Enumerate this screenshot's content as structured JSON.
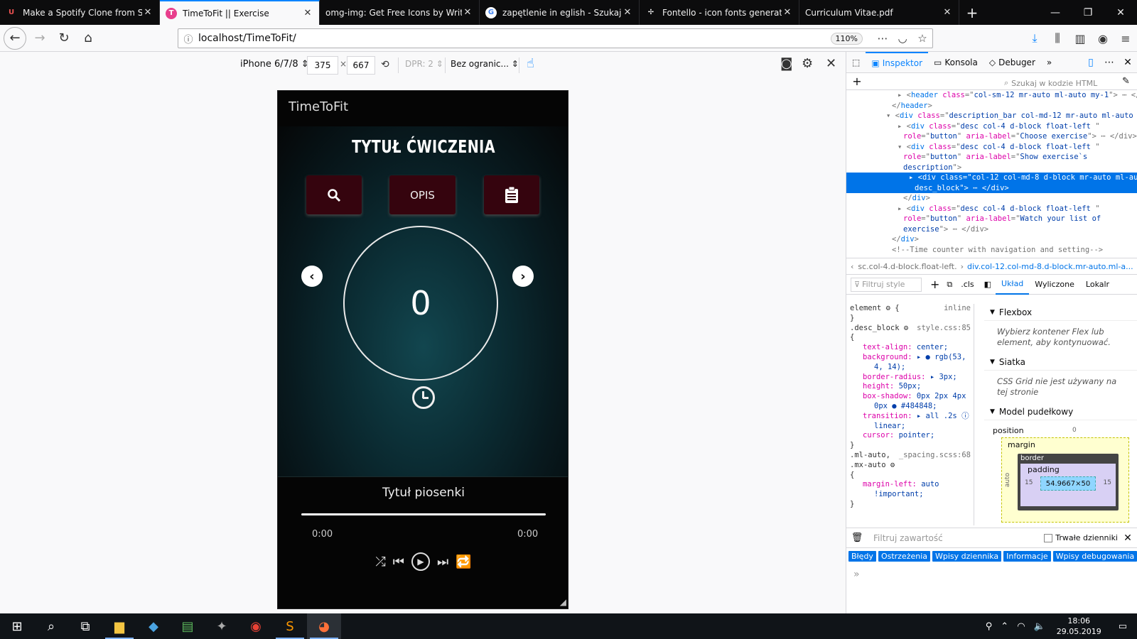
{
  "tabs": [
    {
      "title": "Make a Spotify Clone from Scra",
      "active": false
    },
    {
      "title": "TimeToFit || Exercise",
      "active": true
    },
    {
      "title": "omg-img: Get Free Icons by Writin",
      "active": false
    },
    {
      "title": "zapętlenie in eglish - Szukaj w G",
      "active": false
    },
    {
      "title": "Fontello - icon fonts generator",
      "active": false
    },
    {
      "title": "Curriculum Vitae.pdf",
      "active": false
    }
  ],
  "address": {
    "url": "localhost/TimeToFit/",
    "zoom": "110%"
  },
  "rdm": {
    "device": "iPhone 6/7/8 ⇕",
    "width": "375",
    "height": "667",
    "dpr": "DPR: 2 ⇕",
    "throttle": "Bez ogranic... ⇕"
  },
  "app": {
    "brand": "TimeToFit",
    "exercise_title": "TYTUŁ ĆWICZENIA",
    "opis_button": "OPIS",
    "timer_value": "0",
    "song_title": "Tytuł piosenki",
    "time_left": "0:00",
    "time_right": "0:00"
  },
  "devtools": {
    "tabs": {
      "inspector": "Inspektor",
      "console": "Konsola",
      "debugger": "Debuger"
    },
    "search_placeholder": "Szukaj w kodzie HTML",
    "tree": [
      {
        "indent": 8,
        "html": "▸ &lt;<span class='tag'>header</span> <span class='attr'>class</span>=\"<span class='aval'>col-sm-12 mr-auto ml-auto my-1</span>\"&gt; ⋯ &lt;/header&gt;"
      },
      {
        "indent": 7,
        "html": "&lt;/<span class='tag'>header</span>&gt;"
      },
      {
        "indent": 6,
        "html": "▾ &lt;<span class='tag'>div</span> <span class='attr'>class</span>=\"<span class='aval'>description_bar col-md-12 mr-auto ml-auto</span>"
      },
      {
        "indent": 8,
        "html": "▸ &lt;<span class='tag'>div</span> <span class='attr'>class</span>=\"<span class='aval'>desc col-4 d-block float-left </span>\""
      },
      {
        "indent": 9,
        "html": "<span class='attr'>role</span>=\"<span class='aval'>button</span>\" <span class='attr'>aria-label</span>=\"<span class='aval'>Choose exercise</span>\"&gt; ⋯ &lt;/div&gt;"
      },
      {
        "indent": 8,
        "html": "▾ &lt;<span class='tag'>div</span> <span class='attr'>class</span>=\"<span class='aval'>desc col-4 d-block float-left </span>\""
      },
      {
        "indent": 9,
        "html": "<span class='attr'>role</span>=\"<span class='aval'>button</span>\" <span class='attr'>aria-label</span>=\"<span class='aval'>Show exercise`s</span>"
      },
      {
        "indent": 9,
        "html": "<span class='aval'>description</span>\"&gt;"
      },
      {
        "indent": 10,
        "sel": true,
        "html": "▸ &lt;<span class='tag'>div</span> <span class='attr'>class</span>=\"<span class='aval'>col-12 col-md-8 d-block mr-auto ml-au</span>"
      },
      {
        "indent": 11,
        "sel": true,
        "html": "<span class='aval'>desc_block</span>\"&gt; ⋯ &lt;/div&gt;"
      },
      {
        "indent": 9,
        "html": "&lt;/<span class='tag'>div</span>&gt;"
      },
      {
        "indent": 8,
        "html": "▸ &lt;<span class='tag'>div</span> <span class='attr'>class</span>=\"<span class='aval'>desc col-4 d-block float-left </span>\""
      },
      {
        "indent": 9,
        "html": "<span class='attr'>role</span>=\"<span class='aval'>button</span>\" <span class='attr'>aria-label</span>=\"<span class='aval'>Watch your list of</span>"
      },
      {
        "indent": 9,
        "html": "<span class='aval'>exercise</span>\"&gt; ⋯ &lt;/div&gt;"
      },
      {
        "indent": 7,
        "html": "&lt;/<span class='tag'>div</span>&gt;"
      },
      {
        "indent": 7,
        "html": "<span class='comment'>&lt;!--Time counter with navigation and setting--&gt;</span>"
      }
    ],
    "breadcrumb_1": "sc.col-4.d-block.float-left.",
    "breadcrumb_2": "div.col-12.col-md-8.d-block.mr-auto.ml-a...",
    "filter_styles": "Filtruj style",
    "cls": ".cls",
    "layout_tabs": {
      "uklad": "Układ",
      "wyliczone": "Wyliczone",
      "lokalne": "Lokalr"
    },
    "rules": [
      {
        "sel": "element ⚙ {",
        "src": "inline"
      },
      {
        "line": "}"
      },
      {
        "sel": ".desc_block ⚙",
        "src": "style.css:85"
      },
      {
        "line": "{"
      },
      {
        "prop": "text-align",
        "val": "center;"
      },
      {
        "prop": "background",
        "val": "▸ ● rgb(53,"
      },
      {
        "cont": "4, 14);"
      },
      {
        "prop": "border-radius",
        "val": "▸ 3px;"
      },
      {
        "prop": "height",
        "val": "50px;"
      },
      {
        "prop": "box-shadow",
        "val": "0px 2px 4px"
      },
      {
        "cont": "   0px ● #484848;"
      },
      {
        "prop": "transition",
        "val": "▸ all .2s ⓘ"
      },
      {
        "cont": "linear;"
      },
      {
        "prop": "cursor",
        "val": "pointer;"
      },
      {
        "line": "}"
      },
      {
        "sel": ".ml-auto,",
        "src": "_spacing.scss:68"
      },
      {
        "line": ".mx-auto ⚙"
      },
      {
        "line": "{"
      },
      {
        "prop": "margin-left",
        "val": "auto"
      },
      {
        "cont": "   !important;"
      },
      {
        "line": "}"
      }
    ],
    "flexbox": "Flexbox",
    "flexbox_msg": "Wybierz kontener Flex lub element, aby kontynuować.",
    "grid": "Siatka",
    "grid_msg": "CSS Grid nie jest używany na tej stronie",
    "boxmodel": "Model pudełkowy",
    "box": {
      "position": "position",
      "margin": "margin",
      "border": "border",
      "padding": "padding",
      "content": "54.9667×50",
      "zero": "0",
      "fifteen": "15",
      "auto": "auto"
    },
    "console_filter": "Filtruj zawartość",
    "persist": "Trwałe dzienniki",
    "console_filters": [
      "Błędy",
      "Ostrzeżenia",
      "Wpisy dziennika",
      "Informacje",
      "Wpisy debugowania"
    ],
    "prompt": "»"
  },
  "taskbar": {
    "time": "18:06",
    "date": "29.05.2019"
  }
}
